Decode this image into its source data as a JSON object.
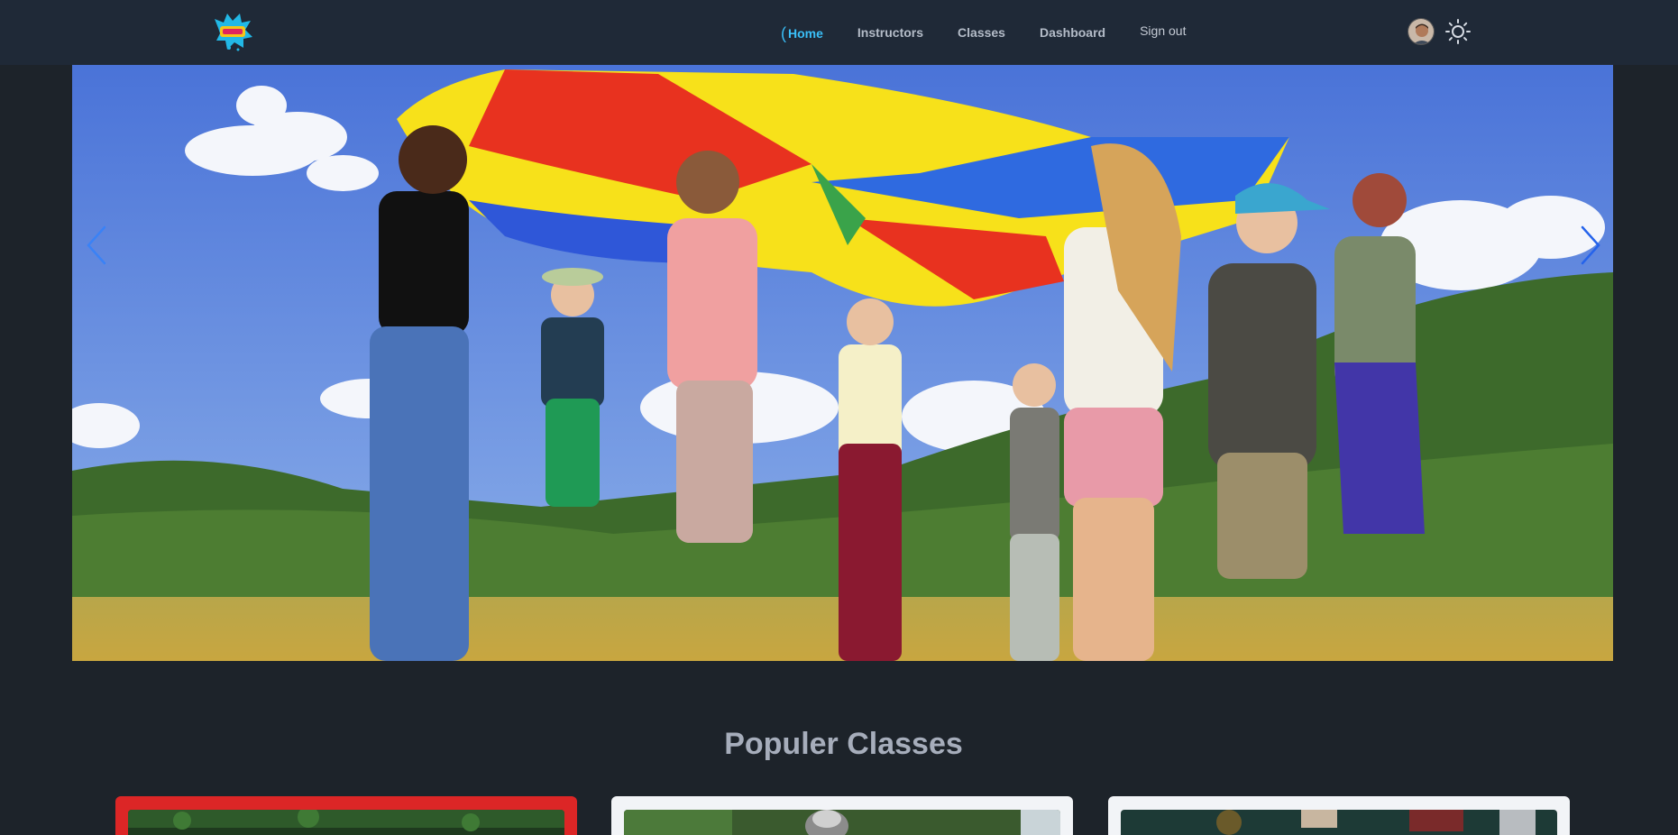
{
  "nav": {
    "logo": "site-logo",
    "links": [
      {
        "label": "Home",
        "active": true
      },
      {
        "label": "Instructors",
        "active": false
      },
      {
        "label": "Classes",
        "active": false
      },
      {
        "label": "Dashboard",
        "active": false
      }
    ],
    "signout_label": "Sign out",
    "accent_color": "#3abff8"
  },
  "hero": {
    "prev_icon": "chevron-left-icon",
    "next_icon": "chevron-right-icon"
  },
  "section": {
    "title": "Populer Classes"
  },
  "cards": [
    {
      "border_color": "#dc2626"
    },
    {
      "border_color": "#f2f4f7"
    },
    {
      "border_color": "#f2f4f7"
    }
  ]
}
